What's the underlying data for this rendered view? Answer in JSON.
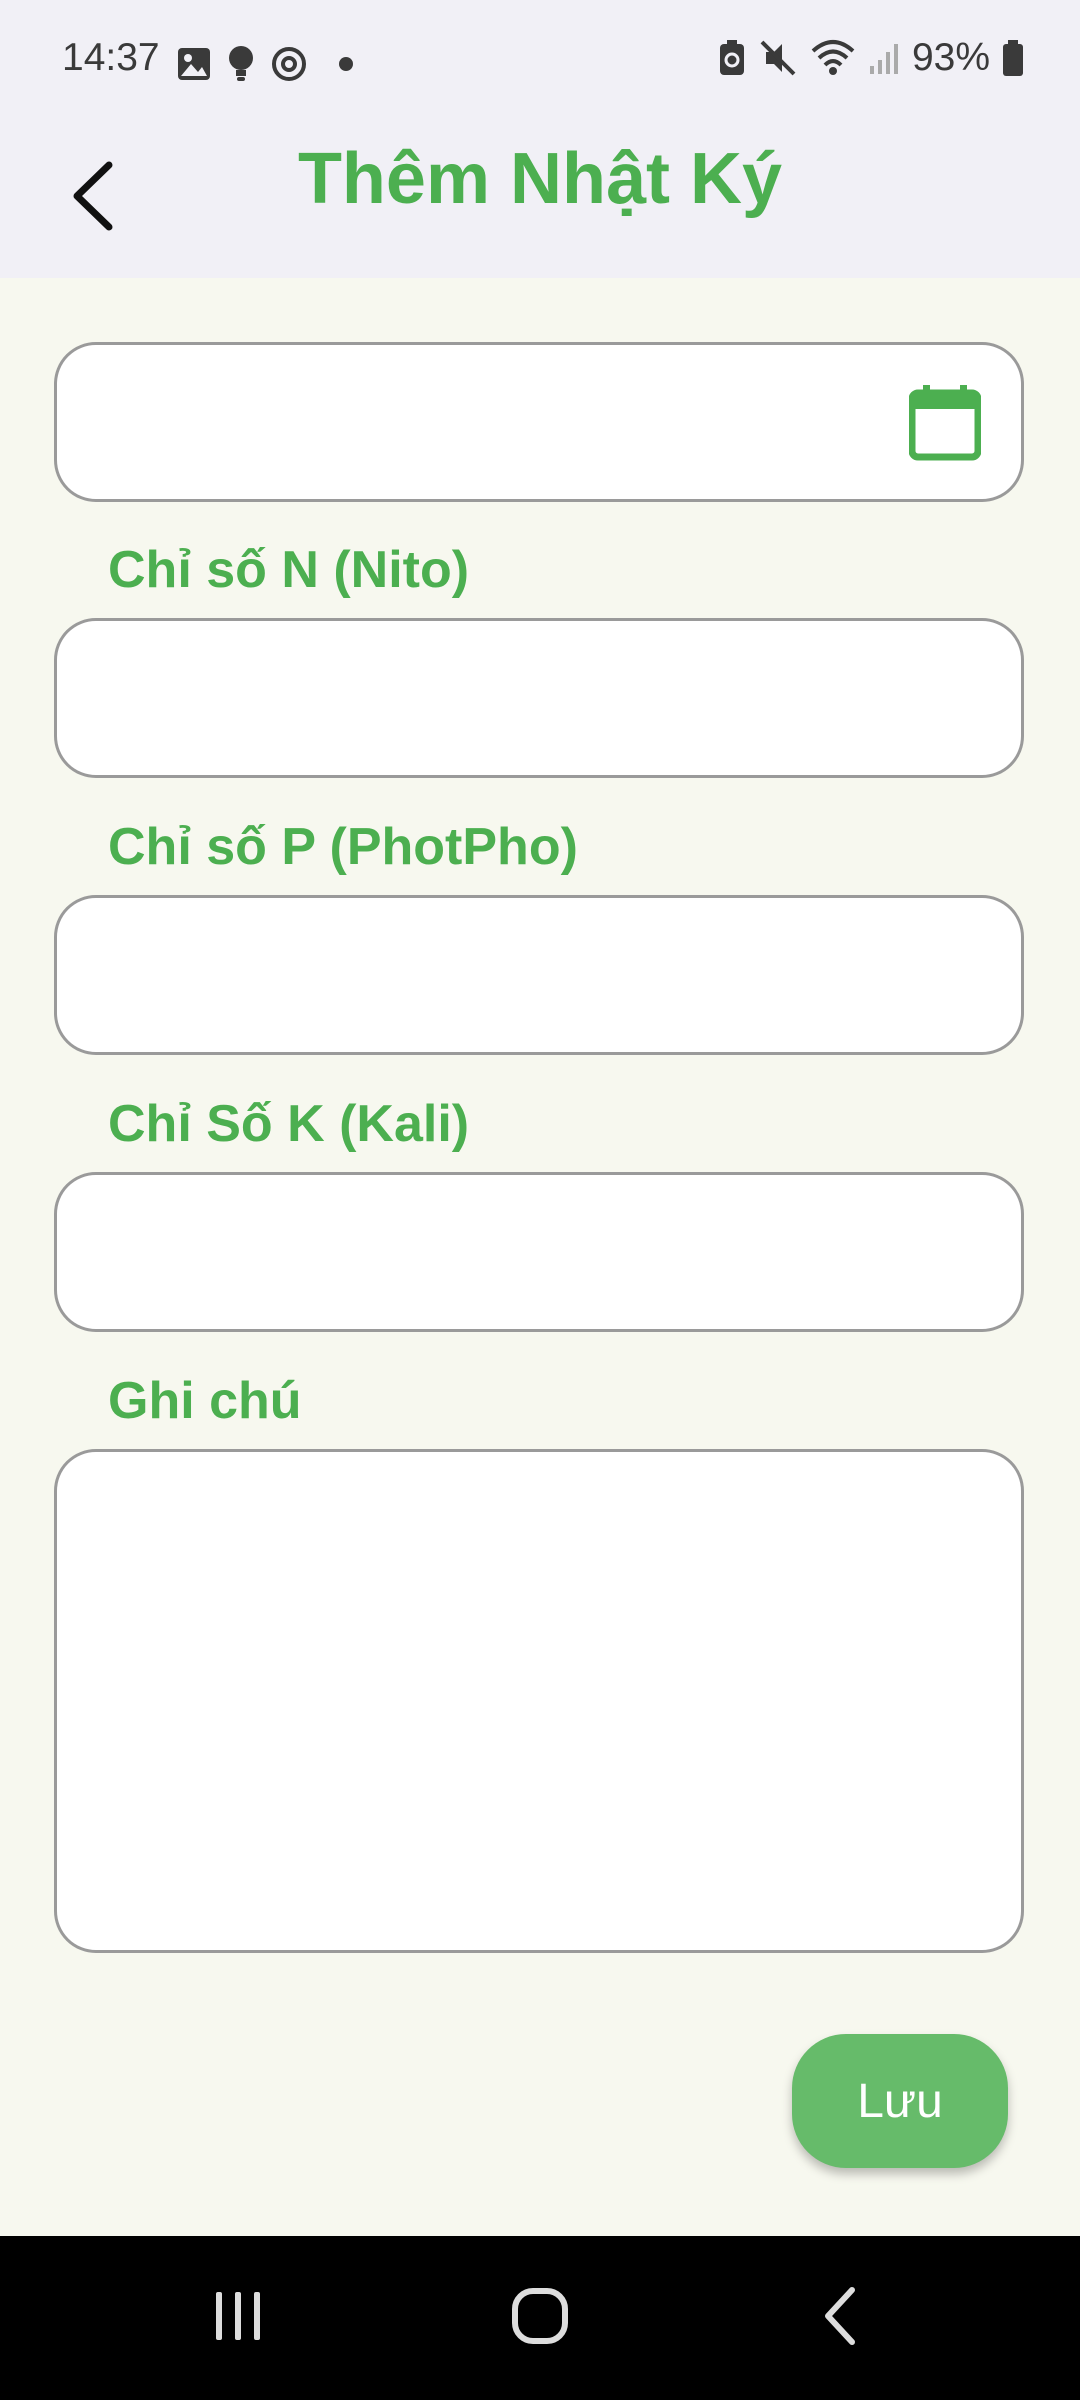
{
  "status_bar": {
    "time": "14:37",
    "battery": "93%",
    "icons": [
      "image-icon",
      "bulb-icon",
      "sync-icon",
      "dot-icon",
      "battery-saver-icon",
      "mute-icon",
      "wifi-icon",
      "signal-icon",
      "battery-icon"
    ]
  },
  "header": {
    "title": "Thêm Nhật Ký",
    "back_icon": "back-arrow-icon"
  },
  "form": {
    "date": {
      "value": "",
      "placeholder": "",
      "icon": "calendar-icon"
    },
    "nitrogen": {
      "label": "Chỉ số N (Nito)",
      "value": ""
    },
    "phosphorus": {
      "label": "Chỉ số P (PhotPho)",
      "value": ""
    },
    "potassium": {
      "label": "Chỉ Số K (Kali)",
      "value": ""
    },
    "note": {
      "label": "Ghi chú",
      "value": ""
    },
    "save_label": "Lưu"
  },
  "colors": {
    "accent": "#4caf50",
    "button": "#66bb6a",
    "background": "#f7f8ef",
    "header_bg": "#f1f0f6"
  },
  "nav_bar": {
    "items": [
      "recents-icon",
      "home-icon",
      "back-icon"
    ]
  }
}
